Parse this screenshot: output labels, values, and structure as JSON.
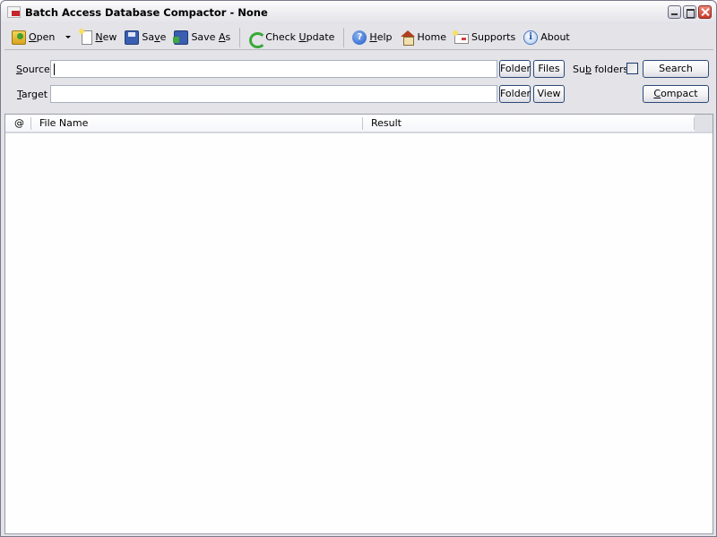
{
  "window": {
    "title": "Batch Access Database Compactor - None",
    "controls": {
      "minimize": "minimize",
      "maximize": "maximize",
      "close": "close"
    }
  },
  "toolbar": {
    "items": [
      {
        "label": "Open",
        "access_key": "O",
        "icon": "open-folder-icon",
        "has_dropdown": true
      },
      {
        "label": "New",
        "access_key": "N",
        "icon": "new-document-icon"
      },
      {
        "label": "Save",
        "access_key": "v",
        "icon": "save-disk-icon"
      },
      {
        "label": "Save As",
        "access_key": "A",
        "icon": "save-as-icon"
      },
      {
        "label": "Check Update",
        "access_key": "U",
        "icon": "refresh-update-icon"
      },
      {
        "label": "Help",
        "access_key": "H",
        "icon": "help-icon"
      },
      {
        "label": "Home",
        "icon": "home-icon"
      },
      {
        "label": "Supports",
        "icon": "mail-support-icon"
      },
      {
        "label": "About",
        "icon": "info-icon"
      }
    ]
  },
  "form": {
    "source": {
      "label": "Source",
      "value": "",
      "folder_button": "Folder",
      "files_button": "Files"
    },
    "target": {
      "label": "Target",
      "value": "",
      "folder_button": "Folder",
      "view_button": "View"
    },
    "subfolders": {
      "label": "Sub folders",
      "checked": false
    },
    "search_button": "Search",
    "compact_button": "Compact"
  },
  "list": {
    "columns": [
      "@",
      "File Name",
      "Result"
    ],
    "rows": []
  }
}
